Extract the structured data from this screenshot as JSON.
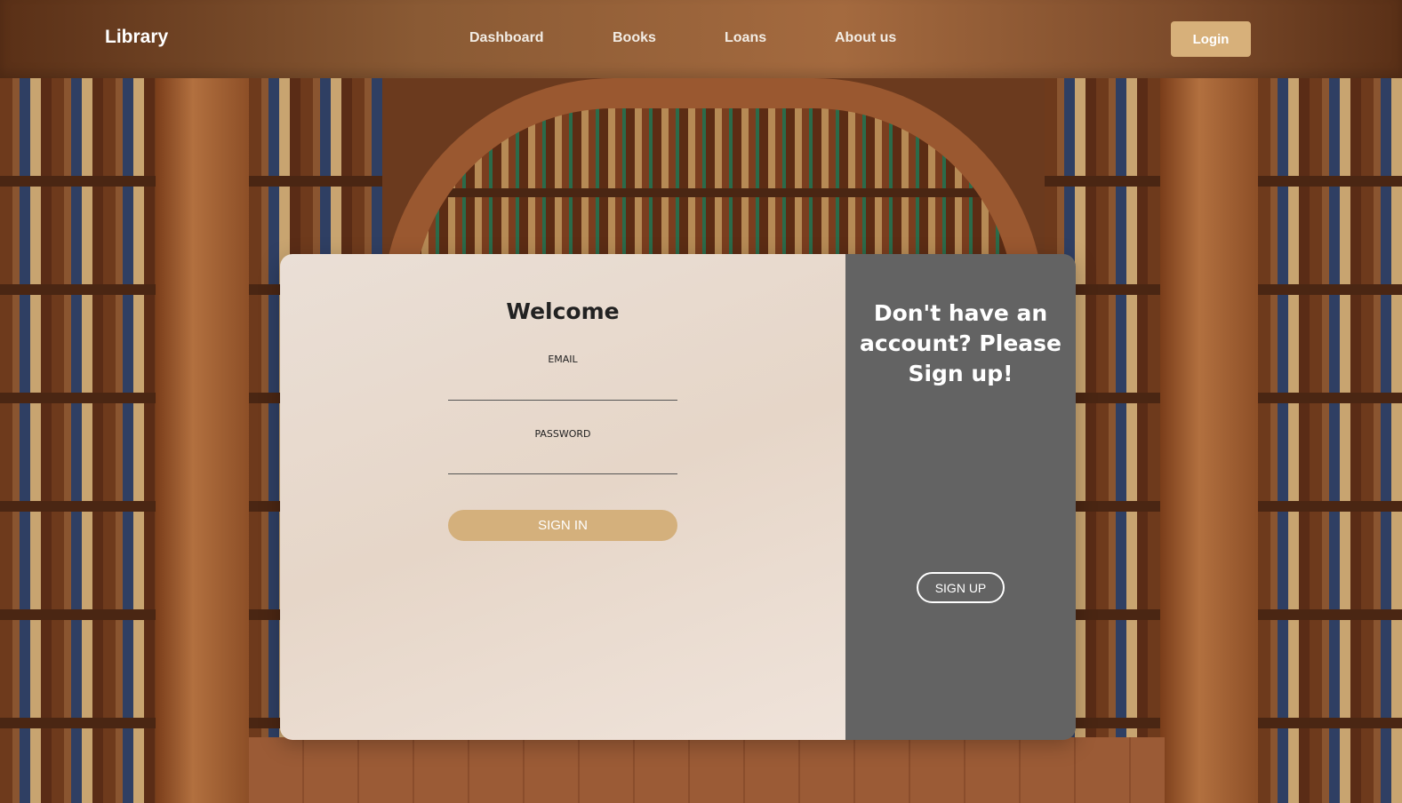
{
  "navbar": {
    "brand": "Library",
    "links": [
      "Dashboard",
      "Books",
      "Loans",
      "About us"
    ],
    "login_label": "Login"
  },
  "signin": {
    "title": "Welcome",
    "email_label": "EMAIL",
    "email_value": "",
    "password_label": "PASSWORD",
    "password_value": "",
    "button_label": "SIGN IN"
  },
  "signup": {
    "title": "Don't have an account? Please Sign up!",
    "button_label": "SIGN UP"
  },
  "colors": {
    "accent": "#d4b07c",
    "panel_gray": "#636363",
    "card_light": "#eadfd6"
  }
}
